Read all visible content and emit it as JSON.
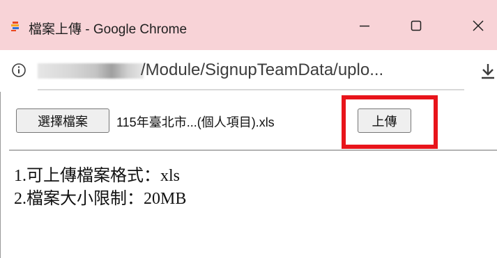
{
  "window": {
    "title": "檔案上傳 - Google Chrome",
    "controls": {
      "minimize_icon": "minimize-icon",
      "maximize_icon": "maximize-icon",
      "close_icon": "close-icon"
    },
    "titlebar_color": "#f8d3d7"
  },
  "addressbar": {
    "url_visible": "/Module/SignupTeamData/uplo...",
    "info_icon": "info-icon",
    "download_icon": "download-icon"
  },
  "upload_form": {
    "choose_file_label": "選擇檔案",
    "file_name": "115年臺北市...(個人項目).xls",
    "upload_label": "上傳",
    "highlight_color": "#e8141b"
  },
  "notes": [
    "1.可上傳檔案格式：xls",
    "2.檔案大小限制：20MB"
  ]
}
